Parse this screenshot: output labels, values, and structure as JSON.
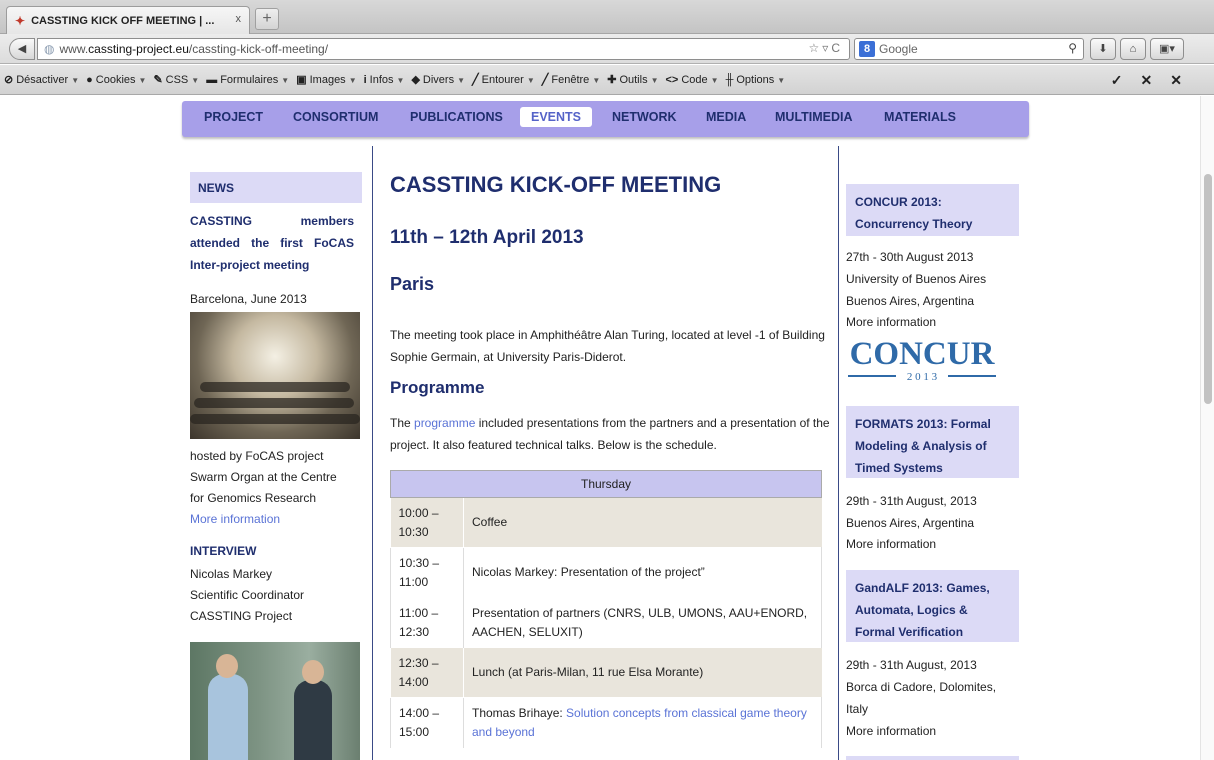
{
  "browser": {
    "tab_title": "CASSTING KICK OFF MEETING | ...",
    "tab_close": "x",
    "new_tab": "+",
    "url_prefix": "www.",
    "url_host": "cassting-project.eu",
    "url_path": "/cassting-kick-off-meeting/",
    "search_placeholder": "Google"
  },
  "devbar": {
    "items": [
      "Désactiver",
      "Cookies",
      "CSS",
      "Formulaires",
      "Images",
      "Infos",
      "Divers",
      "Entourer",
      "Fenêtre",
      "Outils",
      "Code",
      "Options"
    ]
  },
  "sitenav": {
    "items": [
      "PROJECT",
      "CONSORTIUM",
      "PUBLICATIONS",
      "EVENTS",
      "NETWORK",
      "MEDIA",
      "MULTIMEDIA",
      "MATERIALS"
    ],
    "active": "EVENTS"
  },
  "left": {
    "news_title": "NEWS",
    "news_headline": "CASSTING members attended the first FoCAS Inter-project meeting",
    "news_place": "Barcelona, June 2013",
    "news_desc_1": "hosted by FoCAS project",
    "news_desc_2": "Swarm Organ at the Centre",
    "news_desc_3": "for Genomics Research",
    "news_more": "More information",
    "interview_title": "INTERVIEW",
    "interview_name": "Nicolas Markey",
    "interview_role": "Scientific Coordinator",
    "interview_project": "CASSTING Project"
  },
  "main": {
    "title": "CASSTING KICK-OFF MEETING",
    "date": "11th – 12th April 2013",
    "city": "Paris",
    "intro": "The meeting took place in Amphithéâtre Alan Turing, located at level -1 of Building Sophie Germain, at University Paris-Diderot.",
    "programme_heading": "Programme",
    "programme_pre": "The ",
    "programme_link": "programme",
    "programme_post": " included presentations from the partners and a presentation of the project. It also featured technical talks. Below is the schedule.",
    "schedule_day": "Thursday",
    "schedule": [
      {
        "time": "10:00 – 10:30",
        "text": "Coffee"
      },
      {
        "time": "10:30 – 11:00",
        "text": "Nicolas Markey: Presentation of the project”"
      },
      {
        "time": "11:00 – 12:30",
        "text": "Presentation of partners (CNRS, ULB, UMONS, AAU+ENORD, AACHEN, SELUXIT)"
      },
      {
        "time": "12:30 – 14:00",
        "text": "Lunch (at Paris-Milan, 11 rue Elsa Morante)"
      },
      {
        "time": "14:00 – 15:00",
        "speaker": "Thomas Brihaye: ",
        "link": "Solution concepts from classical game theory and beyond"
      }
    ]
  },
  "right": {
    "event1_title": "CONCUR 2013: Concurrency Theory",
    "event1_dates": "27th - 30th August 2013",
    "event1_venue": "University of Buenos Aires",
    "event1_city": "Buenos Aires, Argentina",
    "event1_more": "More information",
    "event1_logo_text": "CONCUR",
    "event1_logo_year": "2 0 1 3",
    "event2_title": "FORMATS 2013: Formal Modeling & Analysis of Timed Systems",
    "event2_dates": "29th - 31th August, 2013",
    "event2_city": "Buenos Aires, Argentina",
    "event2_more": "More information",
    "event3_title": "GandALF 2013: Games, Automata, Logics & Formal Verification",
    "event3_dates": "29th - 31th August, 2013",
    "event3_city": "Borca di Cadore, Dolomites, Italy",
    "event3_more": "More information"
  },
  "colors": {
    "nav_bg": "#a79fe9",
    "heading": "#1f2e6e",
    "link": "#5a73d6",
    "box_bg": "#dcdaf6"
  }
}
